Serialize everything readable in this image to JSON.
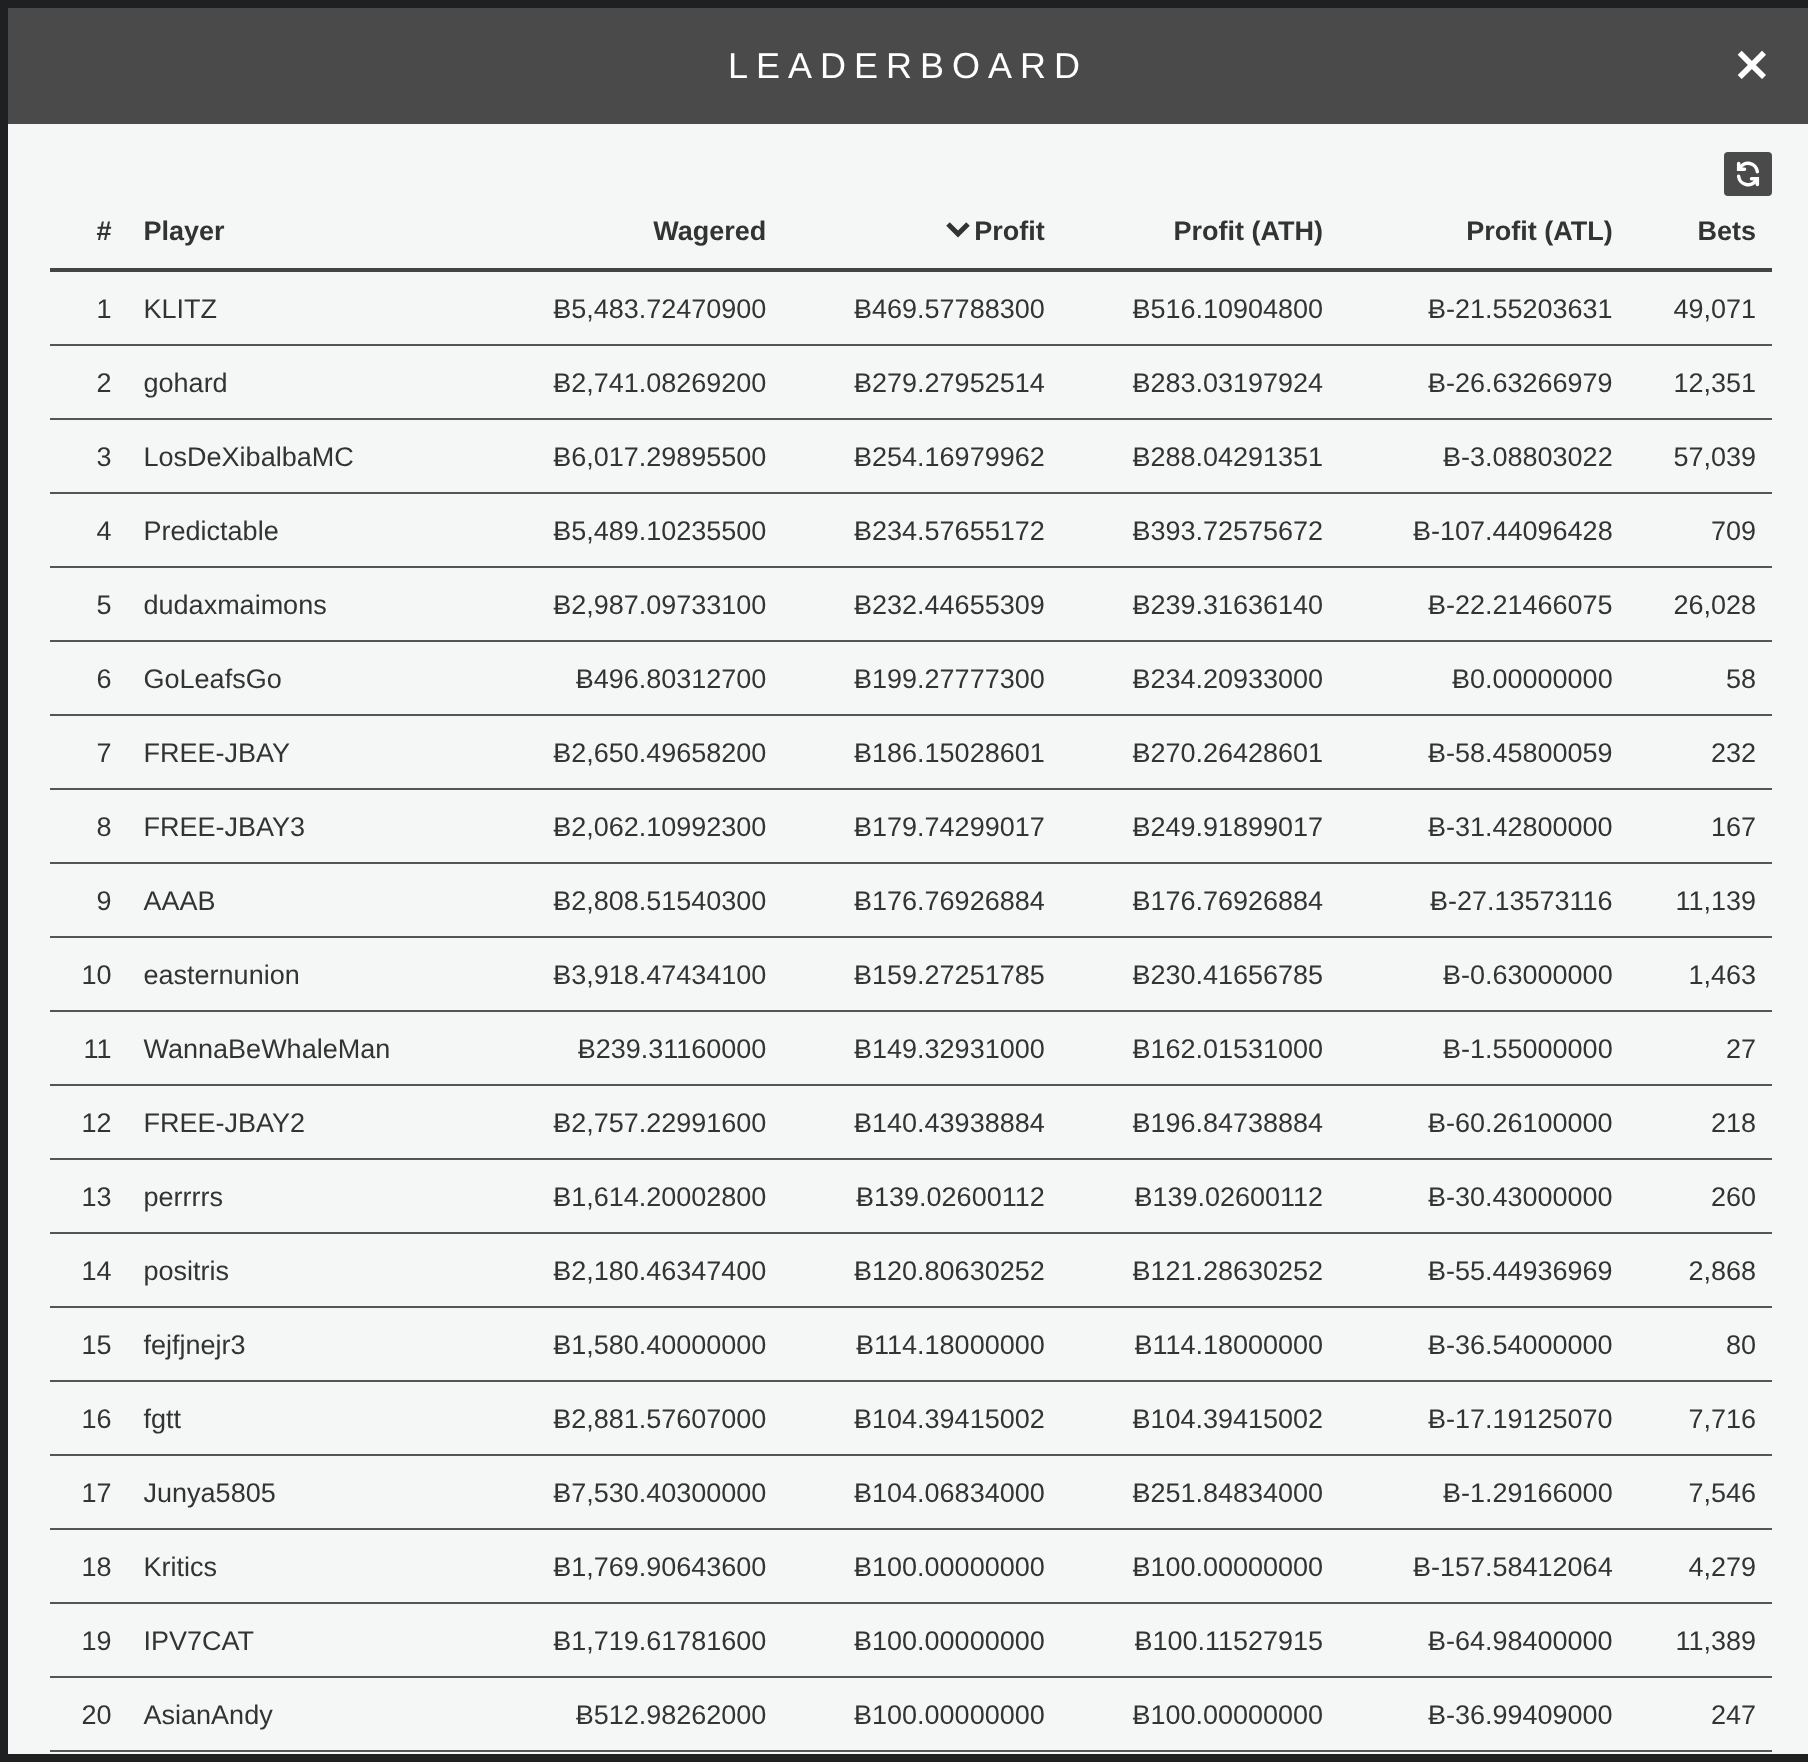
{
  "modal": {
    "title": "LEADERBOARD",
    "close": "×"
  },
  "table": {
    "columns": [
      {
        "label": "#",
        "sorted": false
      },
      {
        "label": "Player",
        "sorted": false
      },
      {
        "label": "Wagered",
        "sorted": false
      },
      {
        "label": "Profit",
        "sorted": true
      },
      {
        "label": "Profit (ATH)",
        "sorted": false
      },
      {
        "label": "Profit (ATL)",
        "sorted": false
      },
      {
        "label": "Bets",
        "sorted": false
      }
    ],
    "rows": [
      [
        "1",
        "KLITZ",
        "Ƀ5,483.72470900",
        "Ƀ469.57788300",
        "Ƀ516.10904800",
        "Ƀ-21.55203631",
        "49,071"
      ],
      [
        "2",
        "gohard",
        "Ƀ2,741.08269200",
        "Ƀ279.27952514",
        "Ƀ283.03197924",
        "Ƀ-26.63266979",
        "12,351"
      ],
      [
        "3",
        "LosDeXibalbaMC",
        "Ƀ6,017.29895500",
        "Ƀ254.16979962",
        "Ƀ288.04291351",
        "Ƀ-3.08803022",
        "57,039"
      ],
      [
        "4",
        "Predictable",
        "Ƀ5,489.10235500",
        "Ƀ234.57655172",
        "Ƀ393.72575672",
        "Ƀ-107.44096428",
        "709"
      ],
      [
        "5",
        "dudaxmaimons",
        "Ƀ2,987.09733100",
        "Ƀ232.44655309",
        "Ƀ239.31636140",
        "Ƀ-22.21466075",
        "26,028"
      ],
      [
        "6",
        "GoLeafsGo",
        "Ƀ496.80312700",
        "Ƀ199.27777300",
        "Ƀ234.20933000",
        "Ƀ0.00000000",
        "58"
      ],
      [
        "7",
        "FREE-JBAY",
        "Ƀ2,650.49658200",
        "Ƀ186.15028601",
        "Ƀ270.26428601",
        "Ƀ-58.45800059",
        "232"
      ],
      [
        "8",
        "FREE-JBAY3",
        "Ƀ2,062.10992300",
        "Ƀ179.74299017",
        "Ƀ249.91899017",
        "Ƀ-31.42800000",
        "167"
      ],
      [
        "9",
        "AAAB",
        "Ƀ2,808.51540300",
        "Ƀ176.76926884",
        "Ƀ176.76926884",
        "Ƀ-27.13573116",
        "11,139"
      ],
      [
        "10",
        "easternunion",
        "Ƀ3,918.47434100",
        "Ƀ159.27251785",
        "Ƀ230.41656785",
        "Ƀ-0.63000000",
        "1,463"
      ],
      [
        "11",
        "WannaBeWhaleMan",
        "Ƀ239.31160000",
        "Ƀ149.32931000",
        "Ƀ162.01531000",
        "Ƀ-1.55000000",
        "27"
      ],
      [
        "12",
        "FREE-JBAY2",
        "Ƀ2,757.22991600",
        "Ƀ140.43938884",
        "Ƀ196.84738884",
        "Ƀ-60.26100000",
        "218"
      ],
      [
        "13",
        "perrrrs",
        "Ƀ1,614.20002800",
        "Ƀ139.02600112",
        "Ƀ139.02600112",
        "Ƀ-30.43000000",
        "260"
      ],
      [
        "14",
        "positris",
        "Ƀ2,180.46347400",
        "Ƀ120.80630252",
        "Ƀ121.28630252",
        "Ƀ-55.44936969",
        "2,868"
      ],
      [
        "15",
        "fejfjnejr3",
        "Ƀ1,580.40000000",
        "Ƀ114.18000000",
        "Ƀ114.18000000",
        "Ƀ-36.54000000",
        "80"
      ],
      [
        "16",
        "fgtt",
        "Ƀ2,881.57607000",
        "Ƀ104.39415002",
        "Ƀ104.39415002",
        "Ƀ-17.19125070",
        "7,716"
      ],
      [
        "17",
        "Junya5805",
        "Ƀ7,530.40300000",
        "Ƀ104.06834000",
        "Ƀ251.84834000",
        "Ƀ-1.29166000",
        "7,546"
      ],
      [
        "18",
        "Kritics",
        "Ƀ1,769.90643600",
        "Ƀ100.00000000",
        "Ƀ100.00000000",
        "Ƀ-157.58412064",
        "4,279"
      ],
      [
        "19",
        "IPV7CAT",
        "Ƀ1,719.61781600",
        "Ƀ100.00000000",
        "Ƀ100.11527915",
        "Ƀ-64.98400000",
        "11,389"
      ],
      [
        "20",
        "AsianAndy",
        "Ƀ512.98262000",
        "Ƀ100.00000000",
        "Ƀ100.00000000",
        "Ƀ-36.99409000",
        "247"
      ]
    ]
  }
}
